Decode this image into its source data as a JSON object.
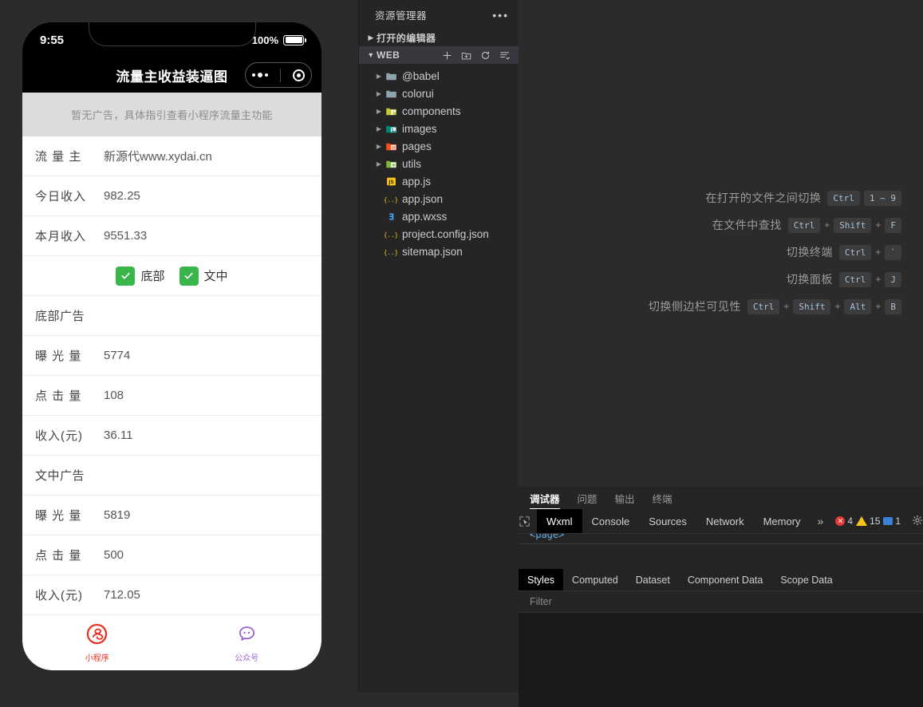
{
  "simulator": {
    "status_bar": {
      "time": "9:55",
      "battery_percent": "100%"
    },
    "nav": {
      "title": "流量主收益装逼图",
      "capsule_more_icon": "more-dots-icon",
      "capsule_target_icon": "target-circle-icon"
    },
    "notice": "暂无广告，具体指引查看小程序流量主功能",
    "rows": [
      {
        "label": "流 量 主",
        "value": "新源代www.xydai.cn"
      },
      {
        "label": "今日收入",
        "value": "982.25"
      },
      {
        "label": "本月收入",
        "value": "9551.33"
      }
    ],
    "checkboxes": [
      {
        "label": "底部",
        "checked": true
      },
      {
        "label": "文中",
        "checked": true
      }
    ],
    "sections": [
      {
        "title": "底部广告",
        "rows": [
          {
            "label": "曝 光 量",
            "value": "5774"
          },
          {
            "label": "点 击 量",
            "value": "108"
          },
          {
            "label": "收入(元)",
            "value": "36.11"
          }
        ]
      },
      {
        "title": "文中广告",
        "rows": [
          {
            "label": "曝 光 量",
            "value": "5819"
          },
          {
            "label": "点 击 量",
            "value": "500"
          },
          {
            "label": "收入(元)",
            "value": "712.05"
          }
        ]
      }
    ],
    "tabbar": [
      {
        "label": "小程序",
        "icon": "mini-program-icon",
        "color": "#e8301f"
      },
      {
        "label": "公众号",
        "icon": "official-account-icon",
        "color": "#9b62d6"
      }
    ],
    "checkbox_color": "#39b54a"
  },
  "sidebar": {
    "title": "资源管理器",
    "more_icon": "ellipsis-icon",
    "open_editors": {
      "label": "打开的编辑器",
      "expanded": false
    },
    "project": {
      "label": "WEB",
      "expanded": true,
      "actions": [
        {
          "name": "new-file-icon",
          "title": "+"
        },
        {
          "name": "new-folder-icon",
          "title": "新建文件夹"
        },
        {
          "name": "refresh-icon",
          "title": "刷新"
        },
        {
          "name": "collapse-all-icon",
          "title": "折叠"
        }
      ]
    },
    "tree": [
      {
        "name": "@babel",
        "type": "folder",
        "expandable": true,
        "icon_color": "#90a4ae"
      },
      {
        "name": "colorui",
        "type": "folder",
        "expandable": true,
        "icon_color": "#90a4ae"
      },
      {
        "name": "components",
        "type": "folder",
        "expandable": true,
        "icon_color": "#c0ca33"
      },
      {
        "name": "images",
        "type": "folder",
        "expandable": true,
        "icon_color": "#00897b"
      },
      {
        "name": "pages",
        "type": "folder",
        "expandable": true,
        "icon_color": "#f4511e"
      },
      {
        "name": "utils",
        "type": "folder",
        "expandable": true,
        "icon_color": "#7cb342"
      },
      {
        "name": "app.js",
        "type": "js",
        "expandable": false,
        "icon_color": "#f5c518"
      },
      {
        "name": "app.json",
        "type": "json",
        "expandable": false,
        "icon_color": "#f5c518"
      },
      {
        "name": "app.wxss",
        "type": "css",
        "expandable": false,
        "icon_color": "#42a5f5"
      },
      {
        "name": "project.config.json",
        "type": "json",
        "expandable": false,
        "icon_color": "#f5c518"
      },
      {
        "name": "sitemap.json",
        "type": "json",
        "expandable": false,
        "icon_color": "#f5c518"
      }
    ]
  },
  "editor": {
    "shortcuts": [
      {
        "label": "在打开的文件之间切换",
        "keys": [
          "Ctrl",
          "1 ~ 9"
        ],
        "separators": []
      },
      {
        "label": "在文件中查找",
        "keys": [
          "Ctrl",
          "Shift",
          "F"
        ],
        "separators": [
          "+",
          "+"
        ]
      },
      {
        "label": "切换终端",
        "keys": [
          "Ctrl",
          "`"
        ],
        "separators": [
          "+"
        ]
      },
      {
        "label": "切换面板",
        "keys": [
          "Ctrl",
          "J"
        ],
        "separators": [
          "+"
        ]
      },
      {
        "label": "切换侧边栏可见性",
        "keys": [
          "Ctrl",
          "Shift",
          "Alt",
          "B"
        ],
        "separators": [
          "+",
          "+",
          "+"
        ]
      }
    ]
  },
  "debugger": {
    "panel_tabs": [
      {
        "label": "调试器",
        "active": true
      },
      {
        "label": "问题",
        "active": false
      },
      {
        "label": "输出",
        "active": false
      },
      {
        "label": "终端",
        "active": false
      }
    ],
    "inspect_icon": "inspect-element-icon",
    "devtools_tabs": [
      {
        "label": "Wxml",
        "active": true
      },
      {
        "label": "Console",
        "active": false
      },
      {
        "label": "Sources",
        "active": false
      },
      {
        "label": "Network",
        "active": false
      },
      {
        "label": "Memory",
        "active": false
      }
    ],
    "more_tabs_icon": "chevron-double-right-icon",
    "badges": [
      {
        "icon": "error-icon",
        "count": "4"
      },
      {
        "icon": "warning-icon",
        "count": "15"
      },
      {
        "icon": "message-icon",
        "count": "1"
      }
    ],
    "settings_icon": "gear-icon",
    "wxml_code": "<page>",
    "styles_tabs": [
      {
        "label": "Styles",
        "active": true
      },
      {
        "label": "Computed",
        "active": false
      },
      {
        "label": "Dataset",
        "active": false
      },
      {
        "label": "Component Data",
        "active": false
      },
      {
        "label": "Scope Data",
        "active": false
      }
    ],
    "filter_placeholder": "Filter"
  }
}
